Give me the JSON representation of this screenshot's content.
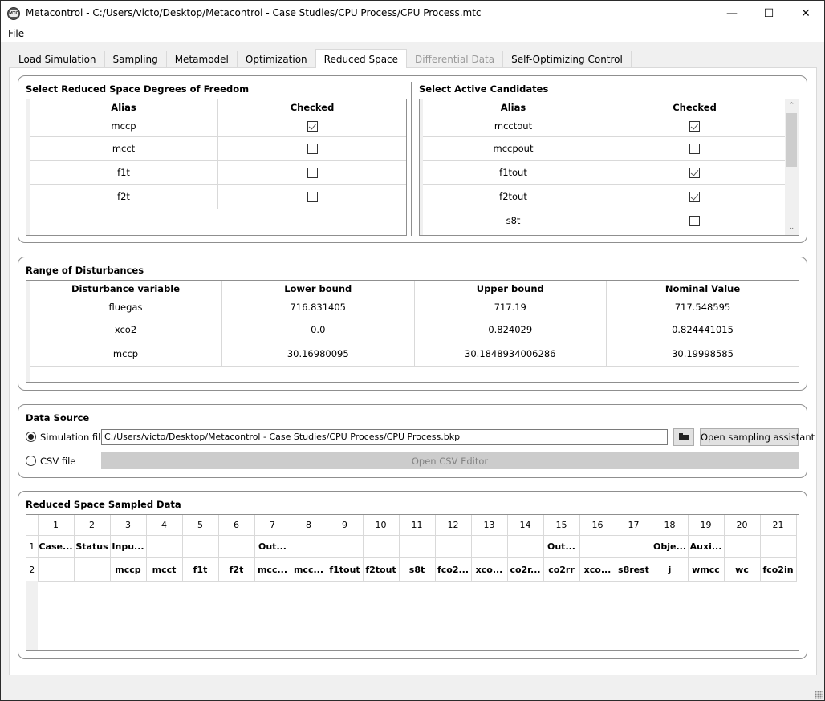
{
  "window": {
    "title": "Metacontrol - C:/Users/victo/Desktop/Metacontrol - Case Studies/CPU Process/CPU Process.mtc",
    "app_icon_text": "MTC",
    "minimize_glyph": "—",
    "maximize_glyph": "☐",
    "close_glyph": "✕"
  },
  "menu": {
    "items": [
      {
        "label": "File"
      }
    ]
  },
  "tabs": [
    {
      "label": "Load Simulation",
      "state": "normal"
    },
    {
      "label": "Sampling",
      "state": "normal"
    },
    {
      "label": "Metamodel",
      "state": "normal"
    },
    {
      "label": "Optimization",
      "state": "normal"
    },
    {
      "label": "Reduced Space",
      "state": "active"
    },
    {
      "label": "Differential Data",
      "state": "disabled"
    },
    {
      "label": "Self-Optimizing Control",
      "state": "normal"
    }
  ],
  "dof": {
    "title": "Select Reduced Space Degrees of Freedom",
    "headers": [
      "Alias",
      "Checked"
    ],
    "rows": [
      {
        "alias": "mccp",
        "checked": true
      },
      {
        "alias": "mcct",
        "checked": false
      },
      {
        "alias": "f1t",
        "checked": false
      },
      {
        "alias": "f2t",
        "checked": false
      }
    ]
  },
  "candidates": {
    "title": "Select Active Candidates",
    "headers": [
      "Alias",
      "Checked"
    ],
    "rows": [
      {
        "alias": "mcctout",
        "checked": true
      },
      {
        "alias": "mccpout",
        "checked": false
      },
      {
        "alias": "f1tout",
        "checked": true
      },
      {
        "alias": "f2tout",
        "checked": true
      },
      {
        "alias": "s8t",
        "checked": false
      }
    ],
    "scroll_up_glyph": "⌃",
    "scroll_down_glyph": "⌄"
  },
  "disturbances": {
    "title": "Range of Disturbances",
    "headers": [
      "Disturbance variable",
      "Lower bound",
      "Upper bound",
      "Nominal Value"
    ],
    "rows": [
      [
        "fluegas",
        "716.831405",
        "717.19",
        "717.548595"
      ],
      [
        "xco2",
        "0.0",
        "0.824029",
        "0.824441015"
      ],
      [
        "mccp",
        "30.16980095",
        "30.1848934006286",
        "30.19998585"
      ]
    ]
  },
  "data_source": {
    "title": "Data Source",
    "simulation_label": "Simulation file",
    "simulation_selected": true,
    "simulation_path": "C:/Users/victo/Desktop/Metacontrol - Case Studies/CPU Process/CPU Process.bkp",
    "csv_label": "CSV file",
    "csv_selected": false,
    "sampling_assistant_label": "Open sampling assistant",
    "csv_editor_label": "Open CSV Editor"
  },
  "sampled": {
    "title": "Reduced Space Sampled Data",
    "column_numbers": [
      "1",
      "2",
      "3",
      "4",
      "5",
      "6",
      "7",
      "8",
      "9",
      "10",
      "11",
      "12",
      "13",
      "14",
      "15",
      "16",
      "17",
      "18",
      "19",
      "20",
      "21"
    ],
    "row_numbers": [
      "1",
      "2"
    ],
    "row1": [
      "Case...",
      "Status",
      "Inpu...",
      "",
      "",
      "",
      "Out...",
      "",
      "",
      "",
      "",
      "",
      "",
      "",
      "Out...",
      "",
      "",
      "Obje...",
      "Auxi...",
      "",
      ""
    ],
    "row2": [
      "",
      "",
      "mccp",
      "mcct",
      "f1t",
      "f2t",
      "mcc...",
      "mcc...",
      "f1tout",
      "f2tout",
      "s8t",
      "fco2...",
      "xco...",
      "co2r...",
      "co2rr",
      "xco...",
      "s8rest",
      "j",
      "wmcc",
      "wc",
      "fco2in"
    ]
  }
}
